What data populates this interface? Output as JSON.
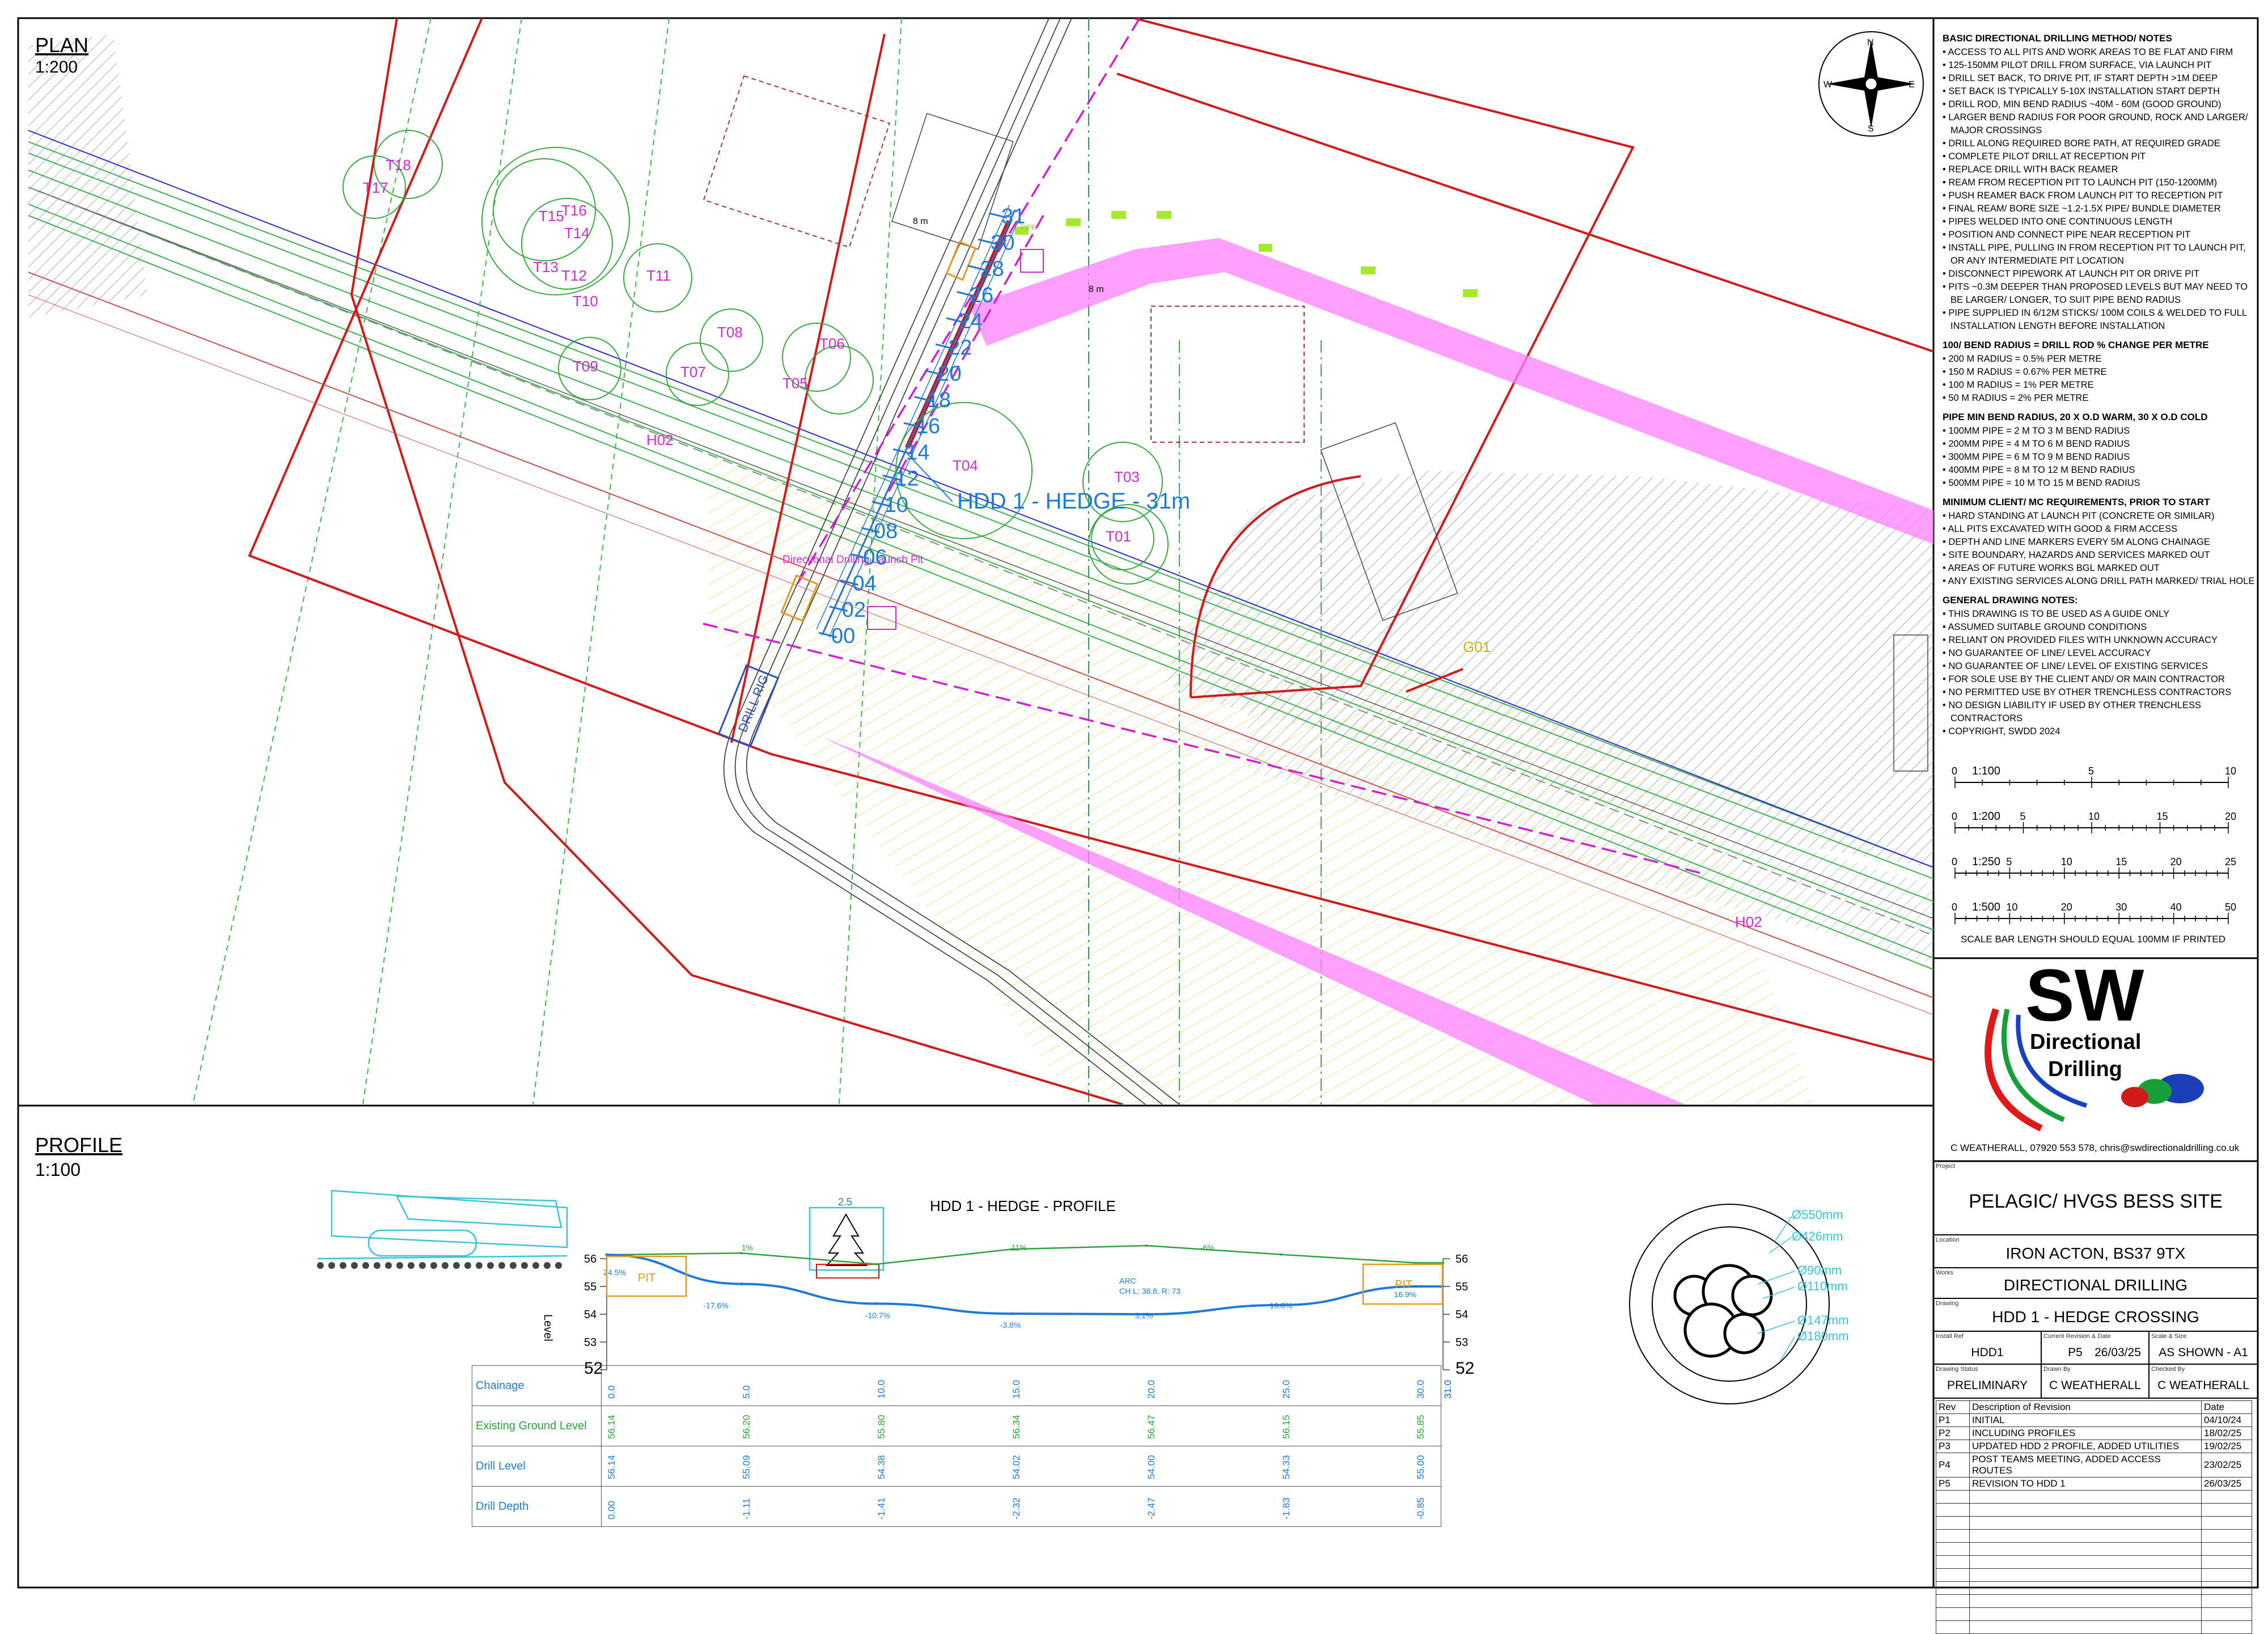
{
  "plan": {
    "title": "PLAN",
    "scale": "1:200"
  },
  "profile": {
    "title": "PROFILE",
    "scale": "1:100",
    "chart_title": "HDD 1 - HEDGE - PROFILE"
  },
  "compass": {
    "n": "N",
    "s": "S",
    "e": "E",
    "w": "W"
  },
  "plan_labels": {
    "hdd_label": "HDD 1 - HEDGE - 31m",
    "launch": "Directional Drilling Launch Pit",
    "drill_rig": "DRILL RIG",
    "g01": "G01",
    "h02_a": "H02",
    "h02_b": "H02",
    "dist_a": "8 m",
    "dist_b": "8 m",
    "trees": [
      "T18",
      "T17",
      "T16",
      "T15",
      "T14",
      "T13",
      "T12",
      "T11",
      "T10",
      "T09",
      "T08",
      "T07",
      "T06",
      "T05",
      "T04",
      "T03",
      "T01"
    ],
    "chainage_marks": [
      "00",
      "02",
      "04",
      "06",
      "08",
      "10",
      "12",
      "14",
      "16",
      "18",
      "20",
      "22",
      "24",
      "26",
      "28",
      "30",
      "31"
    ],
    "pipe_text": "PIPE"
  },
  "notes": {
    "method_title": "BASIC DIRECTIONAL DRILLING METHOD/ NOTES",
    "method": [
      "ACCESS TO ALL PITS AND WORK AREAS TO BE FLAT AND FIRM",
      "125-150MM PILOT DRILL FROM SURFACE, VIA LAUNCH PIT",
      "DRILL SET BACK, TO DRIVE PIT, IF START DEPTH >1M DEEP",
      "SET BACK IS TYPICALLY 5-10X INSTALLATION START DEPTH",
      "DRILL ROD, MIN BEND RADIUS ~40M - 60M (GOOD GROUND)",
      "LARGER BEND RADIUS FOR POOR GROUND, ROCK AND LARGER/ MAJOR CROSSINGS",
      "DRILL ALONG REQUIRED BORE PATH, AT REQUIRED GRADE",
      "COMPLETE PILOT DRILL AT RECEPTION PIT",
      "REPLACE DRILL WITH BACK REAMER",
      "REAM FROM RECEPTION PIT TO LAUNCH PIT (150-1200MM)",
      "PUSH REAMER BACK FROM LAUNCH PIT TO RECEPTION PIT",
      "FINAL REAM/ BORE SIZE ~1.2-1.5X PIPE/ BUNDLE DIAMETER",
      "PIPES WELDED INTO ONE CONTINUOUS LENGTH",
      "POSITION AND CONNECT PIPE NEAR RECEPTION PIT",
      "INSTALL PIPE, PULLING IN FROM RECEPTION PIT TO LAUNCH PIT, OR ANY INTERMEDIATE PIT LOCATION",
      "DISCONNECT PIPEWORK AT LAUNCH PIT OR DRIVE PIT",
      "PITS ~0.3M DEEPER THAN PROPOSED LEVELS BUT MAY NEED TO BE LARGER/ LONGER, TO SUIT PIPE BEND RADIUS",
      "PIPE SUPPLIED IN 6/12M STICKS/ 100M COILS & WELDED TO FULL INSTALLATION LENGTH BEFORE INSTALLATION"
    ],
    "bend_title": "100/ BEND RADIUS = DRILL ROD % CHANGE PER METRE",
    "bend": [
      "200 M RADIUS = 0.5% PER METRE",
      "150 M RADIUS = 0.67% PER METRE",
      "100 M RADIUS = 1% PER METRE",
      "50 M RADIUS = 2% PER METRE"
    ],
    "pipe_title": "PIPE MIN BEND RADIUS, 20 X O.D WARM, 30 X O.D COLD",
    "pipe": [
      "100MM PIPE = 2 M TO 3 M BEND RADIUS",
      "200MM PIPE = 4 M TO 6 M BEND RADIUS",
      "300MM PIPE = 6 M TO 9 M BEND RADIUS",
      "400MM PIPE = 8 M TO 12 M BEND RADIUS",
      "500MM PIPE = 10 M TO 15 M BEND RADIUS"
    ],
    "client_title": "MINIMUM CLIENT/ MC REQUIREMENTS, PRIOR TO START",
    "client": [
      "HARD STANDING AT LAUNCH PIT (CONCRETE OR SIMILAR)",
      "ALL PITS EXCAVATED WITH GOOD & FIRM ACCESS",
      "DEPTH AND LINE MARKERS EVERY 5M ALONG CHAINAGE",
      "SITE BOUNDARY, HAZARDS AND SERVICES MARKED OUT",
      "AREAS OF FUTURE WORKS BGL MARKED OUT",
      "ANY EXISTING SERVICES ALONG DRILL PATH MARKED/ TRIAL HOLE"
    ],
    "general_title": "GENERAL DRAWING NOTES:",
    "general": [
      "THIS DRAWING IS TO BE USED AS A GUIDE ONLY",
      "ASSUMED SUITABLE GROUND CONDITIONS",
      "RELIANT ON PROVIDED FILES WITH UNKNOWN ACCURACY",
      "NO GUARANTEE OF LINE/ LEVEL ACCURACY",
      "NO GUARANTEE OF LINE/ LEVEL OF EXISTING SERVICES",
      "FOR SOLE USE BY THE CLIENT AND/ OR MAIN CONTRACTOR",
      "NO PERMITTED USE BY OTHER TRENCHLESS CONTRACTORS",
      "NO DESIGN LIABILITY IF USED BY OTHER TRENCHLESS CONTRACTORS",
      "COPYRIGHT, SWDD 2024"
    ]
  },
  "scalebars": [
    {
      "label": "1:100",
      "ticks": [
        "0",
        "5",
        "10"
      ]
    },
    {
      "label": "1:200",
      "ticks": [
        "0",
        "5",
        "10",
        "15",
        "20"
      ]
    },
    {
      "label": "1:250",
      "ticks": [
        "0",
        "5",
        "10",
        "15",
        "20",
        "25"
      ]
    },
    {
      "label": "1:500",
      "ticks": [
        "0",
        "10",
        "20",
        "30",
        "40",
        "50"
      ]
    }
  ],
  "scale_note": "SCALE BAR LENGTH SHOULD EQUAL 100MM IF PRINTED",
  "logo": {
    "big": "SW",
    "line1": "Directional",
    "line2": "Drilling"
  },
  "contact": "C WEATHERALL, 07920 553 578, chris@swdirectionaldrilling.co.uk",
  "titleblock": {
    "project_lbl": "Project",
    "project": "PELAGIC/ HVGS BESS SITE",
    "location_lbl": "Location",
    "location": "IRON ACTON, BS37 9TX",
    "works_lbl": "Works",
    "works": "DIRECTIONAL DRILLING",
    "drawing_lbl": "Drawing",
    "drawing": "HDD 1 - HEDGE CROSSING",
    "install_lbl": "Install Ref",
    "install": "HDD1",
    "rev_lbl": "Current Revision & Date",
    "rev": "P5",
    "rev_date": "26/03/25",
    "scale_lbl": "Scale & Size",
    "scale": "AS SHOWN - A1",
    "status_lbl": "Drawing Status",
    "status": "PRELIMINARY",
    "drawn_lbl": "Drawn By",
    "drawn": "C WEATHERALL",
    "checked_lbl": "Checked By",
    "checked": "C WEATHERALL"
  },
  "revisions": {
    "headers": [
      "Rev",
      "Description of Revision",
      "Date"
    ],
    "rows": [
      [
        "P1",
        "INITIAL",
        "04/10/24"
      ],
      [
        "P2",
        "INCLUDING PROFILES",
        "18/02/25"
      ],
      [
        "P3",
        "UPDATED HDD 2 PROFILE, ADDED UTILITIES",
        "19/02/25"
      ],
      [
        "P4",
        "POST TEAMS MEETING, ADDED ACCESS ROUTES",
        "23/02/25"
      ],
      [
        "P5",
        "REVISION TO HDD 1",
        "26/03/25"
      ]
    ]
  },
  "duct": {
    "labels": [
      "Ø550mm",
      "Ø426mm",
      "Ø90mm",
      "Ø110mm",
      "Ø147mm",
      "Ø180mm"
    ]
  },
  "chart_data": {
    "type": "line",
    "title": "HDD 1 - HEDGE - PROFILE",
    "ylabel": "Level",
    "ylim": [
      52,
      56
    ],
    "yticks": [
      "56",
      "55",
      "54",
      "53",
      "52"
    ],
    "x": [
      0.0,
      5.0,
      10.0,
      15.0,
      20.0,
      25.0,
      30.0,
      31.0
    ],
    "x_labels": [
      "0.0",
      "5.0",
      "10.0",
      "15.0",
      "20.0",
      "25.0",
      "30.0",
      "31.0"
    ],
    "series": [
      {
        "name": "Existing Ground Level",
        "values": [
          56.14,
          56.2,
          55.8,
          56.34,
          56.47,
          56.15,
          55.85,
          55.85
        ],
        "labels": [
          "56.14",
          "56.20",
          "55.80",
          "56.34",
          "56.47",
          "56.15",
          "55.85",
          ""
        ]
      },
      {
        "name": "Drill Level",
        "values": [
          56.14,
          55.09,
          54.38,
          54.02,
          54.0,
          54.33,
          55.0,
          55.0
        ],
        "labels": [
          "56.14",
          "55.09",
          "54.38",
          "54.02",
          "54.00",
          "54.33",
          "55.00",
          ""
        ]
      },
      {
        "name": "Drill Depth",
        "values": [
          0.0,
          -1.11,
          -1.41,
          -2.32,
          -2.47,
          -1.83,
          -0.85,
          -0.85
        ],
        "labels": [
          "0.00",
          "-1.11",
          "-1.41",
          "-2.32",
          "-2.47",
          "-1.83",
          "-0.85",
          ""
        ]
      }
    ],
    "row_headers": [
      "Chainage",
      "Existing Ground Level",
      "Drill Level",
      "Drill Depth"
    ],
    "grade_labels": [
      "24.5%",
      "-17.6%",
      "-10.7%",
      "-3.8%",
      "3.1%",
      "10.0%",
      "16.9%"
    ],
    "ground_grades": [
      "1%",
      "11%",
      "-6%"
    ],
    "arc_note": "ARC\nCH L: 38.8, R: 73",
    "pit_left": "PIT",
    "pit_right": "PIT",
    "hedge_width": "2.5"
  }
}
